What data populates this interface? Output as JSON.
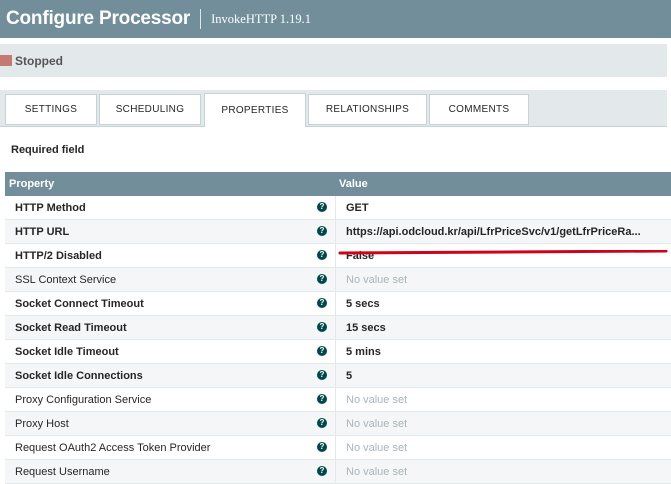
{
  "header": {
    "title": "Configure Processor",
    "subtitle": "InvokeHTTP 1.19.1"
  },
  "status": {
    "label": "Stopped",
    "color": "#ba554a"
  },
  "tabs": [
    {
      "label": "SETTINGS",
      "active": false
    },
    {
      "label": "SCHEDULING",
      "active": false
    },
    {
      "label": "PROPERTIES",
      "active": true
    },
    {
      "label": "RELATIONSHIPS",
      "active": false
    },
    {
      "label": "COMMENTS",
      "active": false
    }
  ],
  "required_label": "Required field",
  "table": {
    "headers": {
      "property": "Property",
      "value": "Value"
    },
    "rows": [
      {
        "name": "HTTP Method",
        "required": true,
        "value": "GET",
        "set": true
      },
      {
        "name": "HTTP URL",
        "required": true,
        "value": "https://api.odcloud.kr/api/LfrPriceSvc/v1/getLfrPriceRa...",
        "set": true,
        "annotated": true
      },
      {
        "name": "HTTP/2 Disabled",
        "required": true,
        "value": "False",
        "set": true
      },
      {
        "name": "SSL Context Service",
        "required": false,
        "value": "No value set",
        "set": false
      },
      {
        "name": "Socket Connect Timeout",
        "required": true,
        "value": "5 secs",
        "set": true
      },
      {
        "name": "Socket Read Timeout",
        "required": true,
        "value": "15 secs",
        "set": true
      },
      {
        "name": "Socket Idle Timeout",
        "required": true,
        "value": "5 mins",
        "set": true
      },
      {
        "name": "Socket Idle Connections",
        "required": true,
        "value": "5",
        "set": true
      },
      {
        "name": "Proxy Configuration Service",
        "required": false,
        "value": "No value set",
        "set": false
      },
      {
        "name": "Proxy Host",
        "required": false,
        "value": "No value set",
        "set": false
      },
      {
        "name": "Request OAuth2 Access Token Provider",
        "required": false,
        "value": "No value set",
        "set": false
      },
      {
        "name": "Request Username",
        "required": false,
        "value": "No value set",
        "set": false
      }
    ]
  },
  "colors": {
    "header_bg": "#728e9b",
    "annotation": "#d0021b",
    "help_icon": "#004849"
  }
}
